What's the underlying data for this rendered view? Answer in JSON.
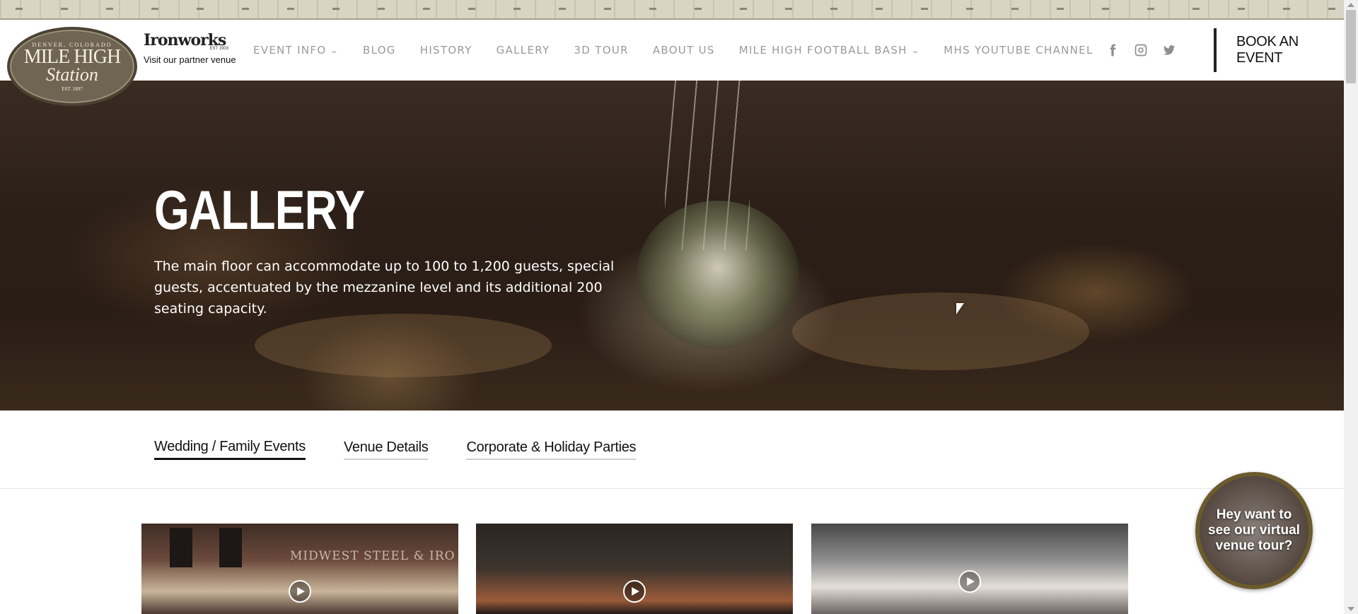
{
  "header": {
    "logo": {
      "top_text": "DENVER, COLORADO",
      "line1": "MILE HIGH",
      "line2": "Station",
      "est": "EST. 1897"
    },
    "partner": {
      "name": "Ironworks",
      "est": "EST 1903",
      "note": "Visit our partner venue"
    },
    "nav": [
      {
        "label": "EVENT INFO",
        "has_dropdown": true
      },
      {
        "label": "BLOG"
      },
      {
        "label": "HISTORY"
      },
      {
        "label": "GALLERY"
      },
      {
        "label": "3D TOUR"
      },
      {
        "label": "ABOUT US"
      },
      {
        "label": "MILE HIGH FOOTBALL BASH",
        "has_dropdown": true
      },
      {
        "label": "MHS YOUTUBE CHANNEL"
      }
    ],
    "social": [
      "facebook-icon",
      "instagram-icon",
      "twitter-icon"
    ],
    "book_button": "BOOK AN EVENT"
  },
  "hero": {
    "title": "GALLERY",
    "text": "The main floor can accommodate up to 100 to 1,200 guests, special guests, accentuated by the mezzanine level and its additional 200 seating capacity."
  },
  "tabs": [
    {
      "label": "Wedding / Family Events",
      "active": true
    },
    {
      "label": "Venue Details"
    },
    {
      "label": "Corporate & Holiday Parties"
    }
  ],
  "gallery": {
    "items": [
      {
        "sign_text": "MIDWEST STEEL & IRO"
      },
      {},
      {}
    ]
  },
  "tour_bubble": {
    "text": "Hey want to see our virtual venue tour?"
  },
  "colors": {
    "nav_text": "#9a9a9a",
    "tour_border": "#6b5a2c",
    "book_border": "#222222"
  }
}
